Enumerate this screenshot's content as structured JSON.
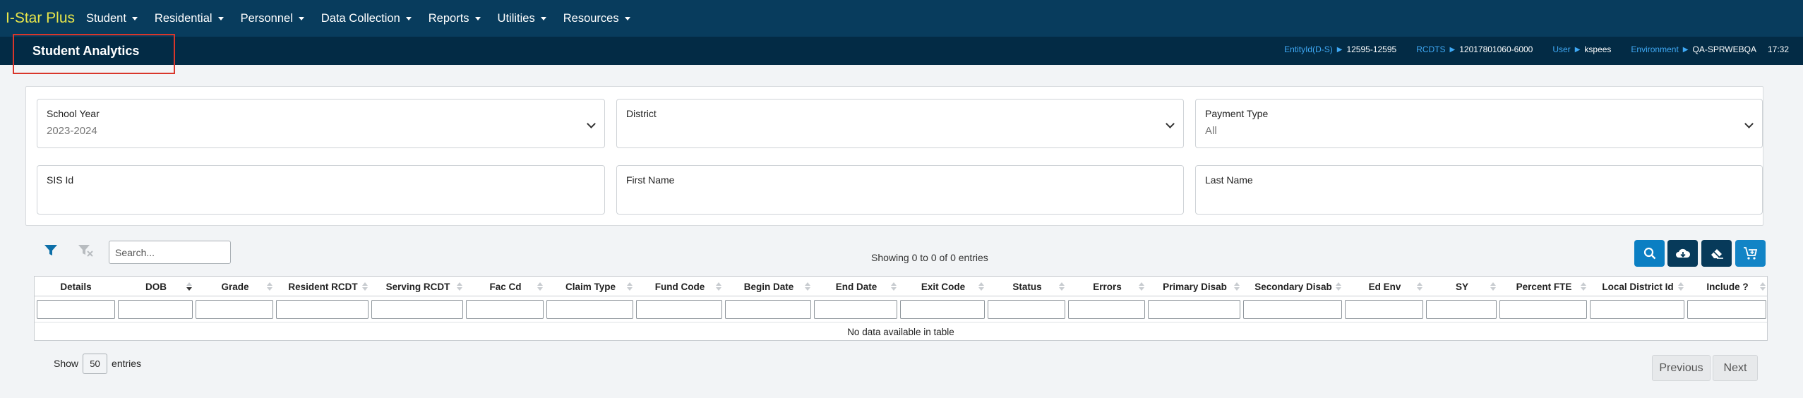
{
  "app": {
    "brand": "I-Star Plus",
    "menu": [
      {
        "label": "Student"
      },
      {
        "label": "Residential"
      },
      {
        "label": "Personnel"
      },
      {
        "label": "Data Collection"
      },
      {
        "label": "Reports"
      },
      {
        "label": "Utilities"
      },
      {
        "label": "Resources"
      }
    ]
  },
  "header": {
    "title": "Student Analytics",
    "entity_label": "EntityId(D-S)",
    "entity_value": "12595-12595",
    "rcdts_label": "RCDTS",
    "rcdts_value": "12017801060-6000",
    "user_label": "User",
    "user_value": "kspees",
    "env_label": "Environment",
    "env_value": "QA-SPRWEBQA",
    "time": "17:32"
  },
  "filters": {
    "school_year": {
      "label": "School Year",
      "value": "2023-2024"
    },
    "district": {
      "label": "District",
      "value": ""
    },
    "payment_type": {
      "label": "Payment Type",
      "value": "All"
    },
    "sis_id": {
      "label": "SIS Id",
      "value": ""
    },
    "first_name": {
      "label": "First Name",
      "value": ""
    },
    "last_name": {
      "label": "Last Name",
      "value": ""
    }
  },
  "toolbar": {
    "search_placeholder": "Search...",
    "info": "Showing 0 to 0 of 0 entries",
    "icons": [
      "search-icon",
      "cloud-download-icon",
      "eraser-icon",
      "cart-add-icon"
    ]
  },
  "table": {
    "columns": [
      "Details",
      "DOB",
      "Grade",
      "Resident RCDT",
      "Serving RCDT",
      "Fac Cd",
      "Claim Type",
      "Fund Code",
      "Begin Date",
      "End Date",
      "Exit Code",
      "Status",
      "Errors",
      "Primary Disab",
      "Secondary Disab",
      "Ed Env",
      "SY",
      "Percent FTE",
      "Local District Id",
      "Include ?"
    ],
    "empty_message": "No data available in table"
  },
  "footer": {
    "show_label": "Show",
    "page_length": "50",
    "entries_label": "entries",
    "previous": "Previous",
    "next": "Next"
  },
  "colors": {
    "nav_bg": "#083c5d",
    "subheader_bg": "#032b45",
    "brand_yellow": "#e8e64a",
    "accent_blue": "#3fa9f5",
    "search_button": "#0b7fc3",
    "dark_button": "#073a5a",
    "cart_button": "#1284c6",
    "title_highlight": "#d9362b"
  }
}
